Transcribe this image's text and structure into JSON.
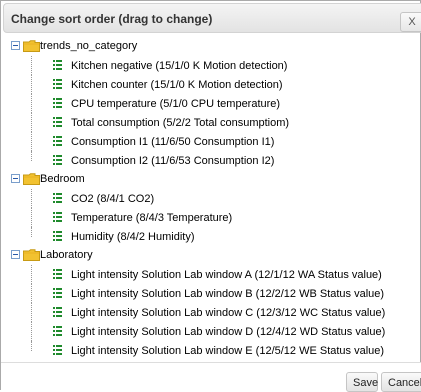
{
  "dialog": {
    "title": "Change sort order (drag to change)",
    "close_label": "X"
  },
  "groups": [
    {
      "label": "trends_no_category",
      "items": [
        "Kitchen negative (15/1/0 K Motion detection)",
        "Kitchen counter (15/1/0 K Motion detection)",
        "CPU temperature (5/1/0 CPU temperature)",
        "Total consumption (5/2/2 Total consumptiom)",
        "Consumption I1 (11/6/50 Consumption I1)",
        "Consumption I2 (11/6/53 Consumption I2)"
      ]
    },
    {
      "label": "Bedroom",
      "items": [
        "CO2 (8/4/1 CO2)",
        "Temperature (8/4/3 Temperature)",
        "Humidity (8/4/2 Humidity)"
      ]
    },
    {
      "label": "Laboratory",
      "items": [
        "Light intensity Solution Lab window A (12/1/12 WA Status value)",
        "Light intensity Solution Lab window B (12/2/12 WB Status value)",
        "Light intensity Solution Lab window C (12/3/12 WC Status value)",
        "Light intensity Solution Lab window D (12/4/12 WD Status value)",
        "Light intensity Solution Lab window E (12/5/12 WE Status value)"
      ]
    }
  ],
  "footer": {
    "save_label": "Save",
    "cancel_label": "Cancel"
  },
  "colors": {
    "folder": "#f2c230",
    "item_icon": "#1f8a2c",
    "tree_toggle": "#7a9ecb"
  },
  "icons": {
    "group_toggle": "collapse-minus-icon",
    "group": "folder-icon",
    "item": "trend-item-icon",
    "close": "close-icon"
  }
}
